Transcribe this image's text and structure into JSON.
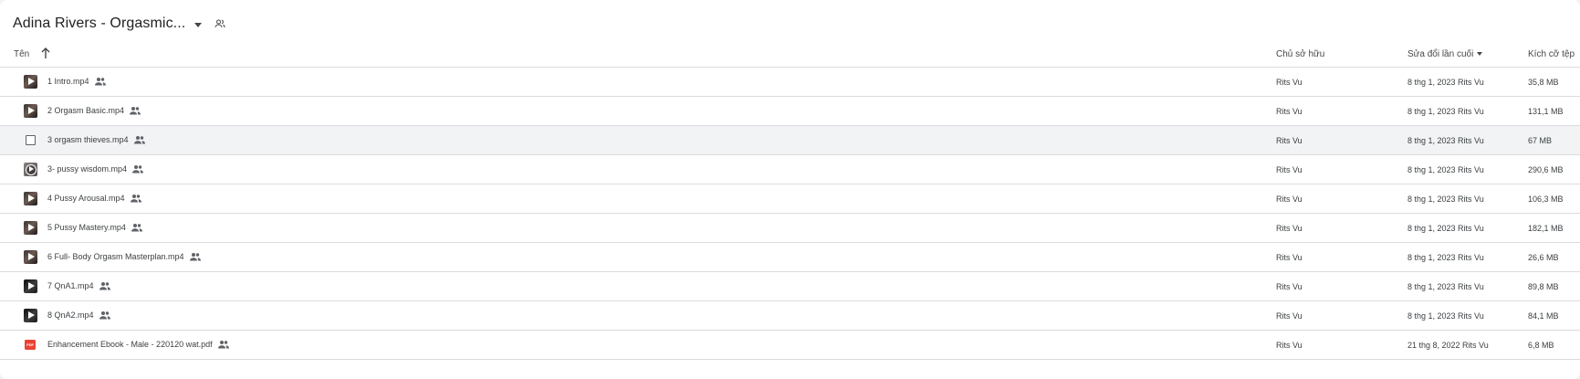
{
  "folder": {
    "title": "Adina Rivers - Orgasmic...",
    "dropdown_icon": "arrow-drop-down-icon",
    "shared_icon": "shared-folder-icon"
  },
  "columns": {
    "name": "Tên",
    "owner": "Chủ sở hữu",
    "modified": "Sửa đổi lần cuối",
    "size": "Kích cỡ tệp",
    "sort_icon": "arrow-upward-icon"
  },
  "files": [
    {
      "name": "1 Intro.mp4",
      "icon": "video-thumbnail",
      "owner": "Rits Vu",
      "modified": "8 thg 1, 2023  Rits Vu",
      "size": "35,8 MB"
    },
    {
      "name": "2 Orgasm Basic.mp4",
      "icon": "video-thumbnail",
      "owner": "Rits Vu",
      "modified": "8 thg 1, 2023  Rits Vu",
      "size": "131,1 MB"
    },
    {
      "name": "3 orgasm thieves.mp4",
      "icon": "checkbox",
      "owner": "Rits Vu",
      "modified": "8 thg 1, 2023  Rits Vu",
      "size": "67 MB"
    },
    {
      "name": "3- pussy wisdom.mp4",
      "icon": "video-thumbnail",
      "owner": "Rits Vu",
      "modified": "8 thg 1, 2023  Rits Vu",
      "size": "290,6 MB"
    },
    {
      "name": "4 Pussy Arousal.mp4",
      "icon": "video-thumbnail",
      "owner": "Rits Vu",
      "modified": "8 thg 1, 2023  Rits Vu",
      "size": "106,3 MB"
    },
    {
      "name": "5 Pussy Mastery.mp4",
      "icon": "video-thumbnail",
      "owner": "Rits Vu",
      "modified": "8 thg 1, 2023  Rits Vu",
      "size": "182,1 MB"
    },
    {
      "name": "6 Full- Body Orgasm Masterplan.mp4",
      "icon": "video-thumbnail",
      "owner": "Rits Vu",
      "modified": "8 thg 1, 2023  Rits Vu",
      "size": "26,6 MB"
    },
    {
      "name": "7 QnA1.mp4",
      "icon": "video-thumbnail",
      "owner": "Rits Vu",
      "modified": "8 thg 1, 2023  Rits Vu",
      "size": "89,8 MB"
    },
    {
      "name": "8 QnA2.mp4",
      "icon": "video-thumbnail",
      "owner": "Rits Vu",
      "modified": "8 thg 1, 2023  Rits Vu",
      "size": "84,1 MB"
    },
    {
      "name": "Enhancement Ebook - Male - 220120 wat.pdf",
      "icon": "pdf-icon",
      "pdf_badge": "PDF",
      "owner": "Rits Vu",
      "modified": "21 thg 8, 2022  Rits Vu",
      "size": "6,8 MB"
    }
  ],
  "colors": {
    "row_selected": "#f1f3f4",
    "pdf_red": "#ea4335",
    "divider": "#dadce0"
  }
}
